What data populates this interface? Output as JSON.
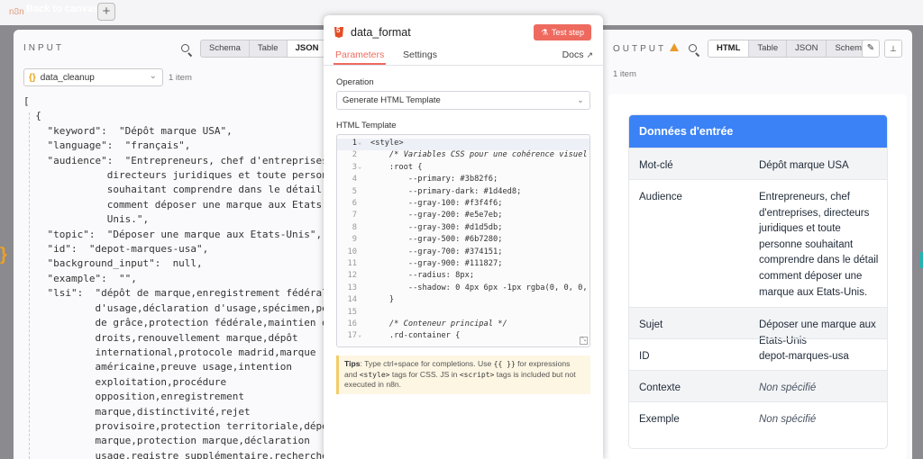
{
  "canvas": {
    "back_label": "Back to canvas",
    "add_label": "+",
    "bg_logo": "n8n",
    "peek_left": "}"
  },
  "input": {
    "label": "INPUT",
    "views": [
      "Schema",
      "Table",
      "JSON"
    ],
    "active_view": "JSON",
    "node_select": "data_cleanup",
    "node_braces": "{}",
    "items_count": "1 item",
    "json_lines": [
      "[",
      "  {",
      "    \"keyword\":  \"Dépôt marque USA\",",
      "    \"language\":  \"français\",",
      "    \"audience\":  \"Entrepreneurs, chef d'entreprises,",
      "              directeurs juridiques et toute personne",
      "              souhaitant comprendre dans le détail",
      "              comment déposer une marque aux Etats-",
      "              Unis.\",",
      "    \"topic\":  \"Déposer une marque aux Etats-Unis\",",
      "    \"id\":  \"depot-marques-usa\",",
      "    \"background_input\":  null,",
      "    \"example\":  \"\",",
      "    \"lsi\":  \"dépôt de marque,enregistrement fédéral,preuve",
      "            d'usage,déclaration d'usage,spécimen,période",
      "            de grâce,protection fédérale,maintien des",
      "            droits,renouvellement marque,dépôt",
      "            international,protocole madrid,marque",
      "            américaine,preuve usage,intention",
      "            exploitation,procédure",
      "            opposition,enregistrement",
      "            marque,distinctivité,rejet",
      "            provisoire,protection territoriale,dépôt",
      "            marque,protection marque,déclaration",
      "            usage,registre supplémentaire,recherche"
    ]
  },
  "node": {
    "title": "data_format",
    "test_button": "Test step",
    "tabs": [
      "Parameters",
      "Settings"
    ],
    "active_tab": "Parameters",
    "docs_label": "Docs",
    "operation_label": "Operation",
    "operation_value": "Generate HTML Template",
    "template_label": "HTML Template",
    "code_lines": [
      {
        "n": "1",
        "fold": "⌄",
        "t": "<style>",
        "cls": "c-tag"
      },
      {
        "n": "2",
        "fold": "",
        "t": "    /* Variables CSS pour une cohérence visuel",
        "cls": "c-com"
      },
      {
        "n": "3",
        "fold": "⌄",
        "t": "    :root {",
        "cls": "c-prop"
      },
      {
        "n": "4",
        "fold": "",
        "t": "        --primary: #3b82f6;",
        "cls": "c-val"
      },
      {
        "n": "5",
        "fold": "",
        "t": "        --primary-dark: #1d4ed8;",
        "cls": "c-val"
      },
      {
        "n": "6",
        "fold": "",
        "t": "        --gray-100: #f3f4f6;",
        "cls": "c-val"
      },
      {
        "n": "7",
        "fold": "",
        "t": "        --gray-200: #e5e7eb;",
        "cls": "c-val"
      },
      {
        "n": "8",
        "fold": "",
        "t": "        --gray-300: #d1d5db;",
        "cls": "c-val"
      },
      {
        "n": "9",
        "fold": "",
        "t": "        --gray-500: #6b7280;",
        "cls": "c-val"
      },
      {
        "n": "10",
        "fold": "",
        "t": "        --gray-700: #374151;",
        "cls": "c-val"
      },
      {
        "n": "11",
        "fold": "",
        "t": "        --gray-900: #111827;",
        "cls": "c-val"
      },
      {
        "n": "12",
        "fold": "",
        "t": "        --radius: 8px;",
        "cls": "c-val"
      },
      {
        "n": "13",
        "fold": "",
        "t": "        --shadow: 0 4px 6px -1px rgba(0, 0, 0,",
        "cls": "c-val"
      },
      {
        "n": "14",
        "fold": "",
        "t": "    }",
        "cls": "c-prop"
      },
      {
        "n": "15",
        "fold": "",
        "t": "",
        "cls": ""
      },
      {
        "n": "16",
        "fold": "",
        "t": "    /* Conteneur principal */",
        "cls": "c-com"
      },
      {
        "n": "17",
        "fold": "⌄",
        "t": "    .rd-container {",
        "cls": "c-prop"
      }
    ],
    "tips_bold": "Tips",
    "tips_text_1": ": Type ctrl+space for completions. Use",
    "tips_code_1": "{{ }}",
    "tips_text_2": "for expressions and",
    "tips_code_2": "<style>",
    "tips_text_3": "tags for CSS. JS in",
    "tips_code_3": "<script>",
    "tips_text_4": "tags is included but not executed in n8n."
  },
  "output": {
    "label": "OUTPUT",
    "views": [
      "HTML",
      "Table",
      "JSON",
      "Schema"
    ],
    "active_view": "HTML",
    "items_count": "1 item",
    "edit_icon": "✎",
    "pin_icon": "📌",
    "card_title": "Données d'entrée",
    "rows": [
      {
        "label": "Mot-clé",
        "value": "Dépôt marque USA",
        "italic": false
      },
      {
        "label": "Audience",
        "value": "Entrepreneurs, chef d'entreprises, directeurs juridiques et toute personne souhaitant comprendre dans le détail comment déposer une marque aux Etats-Unis.",
        "italic": false
      },
      {
        "label": "Sujet",
        "value": "Déposer une marque aux Etats-Unis",
        "italic": false
      },
      {
        "label": "ID",
        "value": "depot-marques-usa",
        "italic": false
      },
      {
        "label": "Contexte",
        "value": "Non spécifié",
        "italic": true
      },
      {
        "label": "Exemple",
        "value": "Non spécifié",
        "italic": true
      }
    ]
  },
  "colors": {
    "accent": "#ee6a5f",
    "html_card_head": "#3b82f6",
    "warning": "#e89a2a"
  }
}
